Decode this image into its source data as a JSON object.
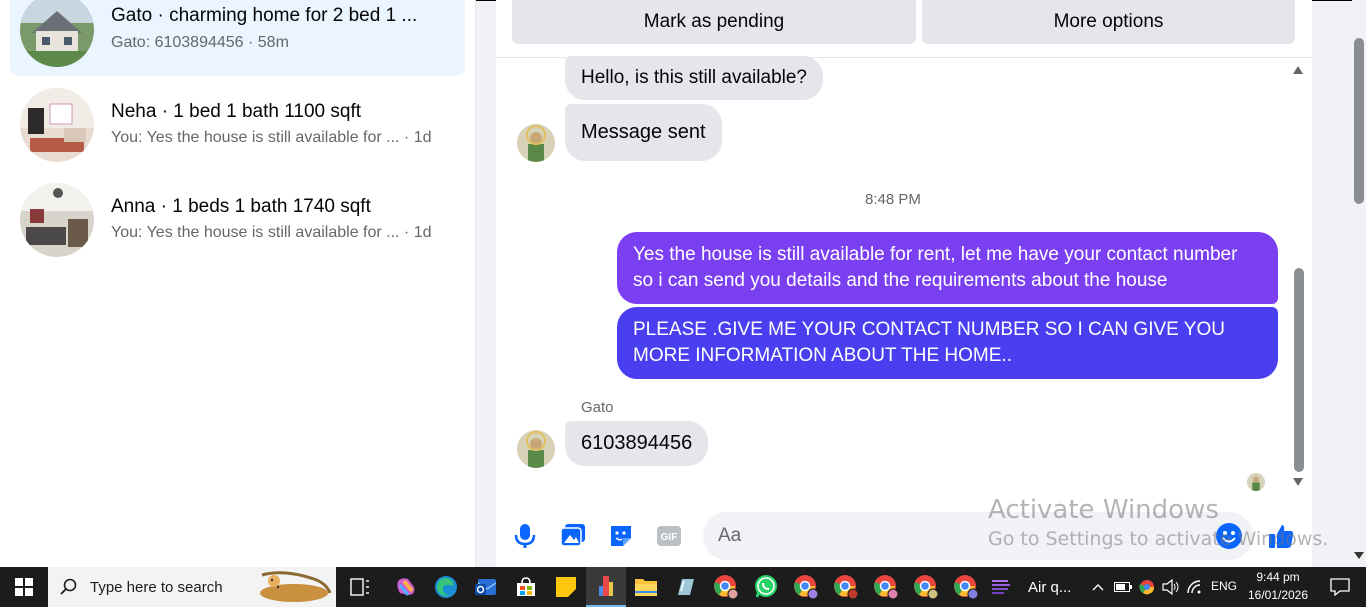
{
  "conversations": [
    {
      "title": "Gato · charming home for 2 bed 1 ...",
      "subtitle": "Gato: 6103894456 · 58m"
    },
    {
      "title": "Neha · 1 bed 1 bath 1100 sqft",
      "subtitle": "You: Yes the house is still available for ... · 1d"
    },
    {
      "title": "Anna · 1 beds 1 bath 1740 sqft",
      "subtitle": "You: Yes the house is still available for ... · 1d"
    }
  ],
  "actions": {
    "pending": "Mark as pending",
    "more": "More options"
  },
  "messages": {
    "m1": "Hello, is this still available?",
    "m2": "Message sent",
    "time": "8:48 PM",
    "m3": "Yes the house is still available for rent, let me have your contact number so i can send you details and the requirements about the house",
    "m4": "PLEASE .GIVE ME YOUR CONTACT NUMBER SO I CAN GIVE YOU MORE INFORMATION ABOUT THE HOME..",
    "sender": "Gato",
    "m5": "6103894456"
  },
  "composer": {
    "placeholder": "Aa"
  },
  "watermark": {
    "line1": "Activate Windows",
    "line2": "Go to Settings to activate Windows."
  },
  "taskbar": {
    "search_placeholder": "Type here to search",
    "app_label": "Air q...",
    "lang": "ENG",
    "time": "9:44 pm",
    "date": "16/01/2026"
  },
  "colors": {
    "accent_purple": "#7b3ff2",
    "accent_blue": "#4a3ff0",
    "active_row": "#ebf5ff"
  }
}
